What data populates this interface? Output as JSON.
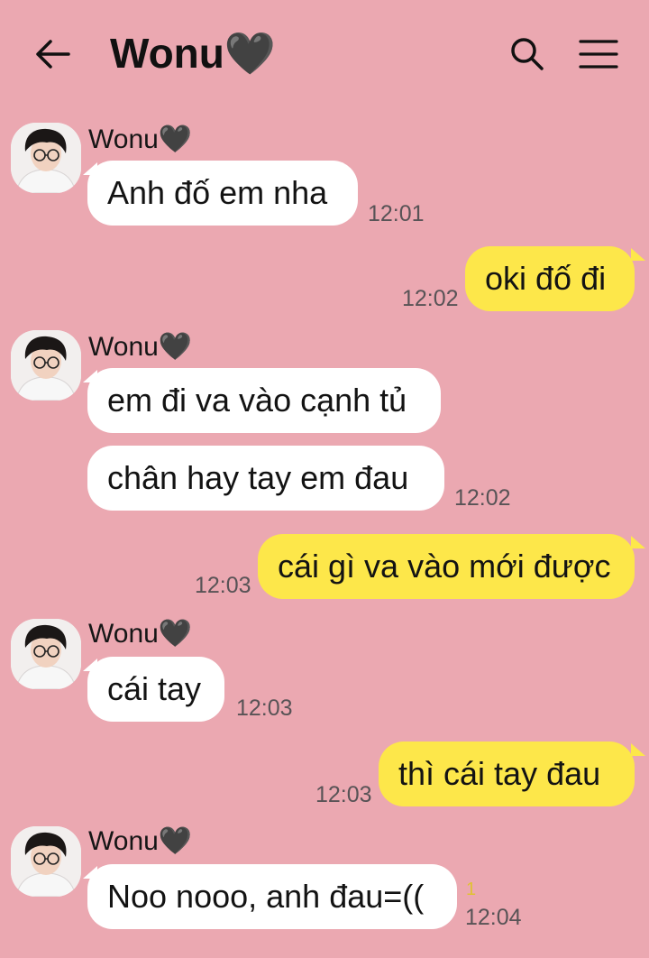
{
  "header": {
    "title": "Wonu🖤",
    "back_icon": "arrow-left-icon",
    "search_icon": "search-icon",
    "menu_icon": "hamburger-menu-icon"
  },
  "colors": {
    "background": "#eba8b1",
    "incoming_bubble": "#ffffff",
    "outgoing_bubble": "#fde74a",
    "time_text": "#585356",
    "unread_count": "#e0c232"
  },
  "messages": [
    {
      "sender": "Wonu🖤",
      "direction": "in",
      "text": "Anh đố em nha",
      "time": "12:01"
    },
    {
      "direction": "out",
      "text": "oki đố đi",
      "time": "12:02"
    },
    {
      "sender": "Wonu🖤",
      "direction": "in",
      "text": "em đi va vào cạnh tủ"
    },
    {
      "direction": "in",
      "text": "chân hay tay em đau",
      "time": "12:02"
    },
    {
      "direction": "out",
      "text": "cái gì va vào mới được",
      "time": "12:03"
    },
    {
      "sender": "Wonu🖤",
      "direction": "in",
      "text": "cái tay",
      "time": "12:03"
    },
    {
      "direction": "out",
      "text": "thì cái tay đau",
      "time": "12:03"
    },
    {
      "sender": "Wonu🖤",
      "direction": "in",
      "text": "Noo nooo, anh đau=((",
      "time": "12:04",
      "unread": "1"
    }
  ]
}
